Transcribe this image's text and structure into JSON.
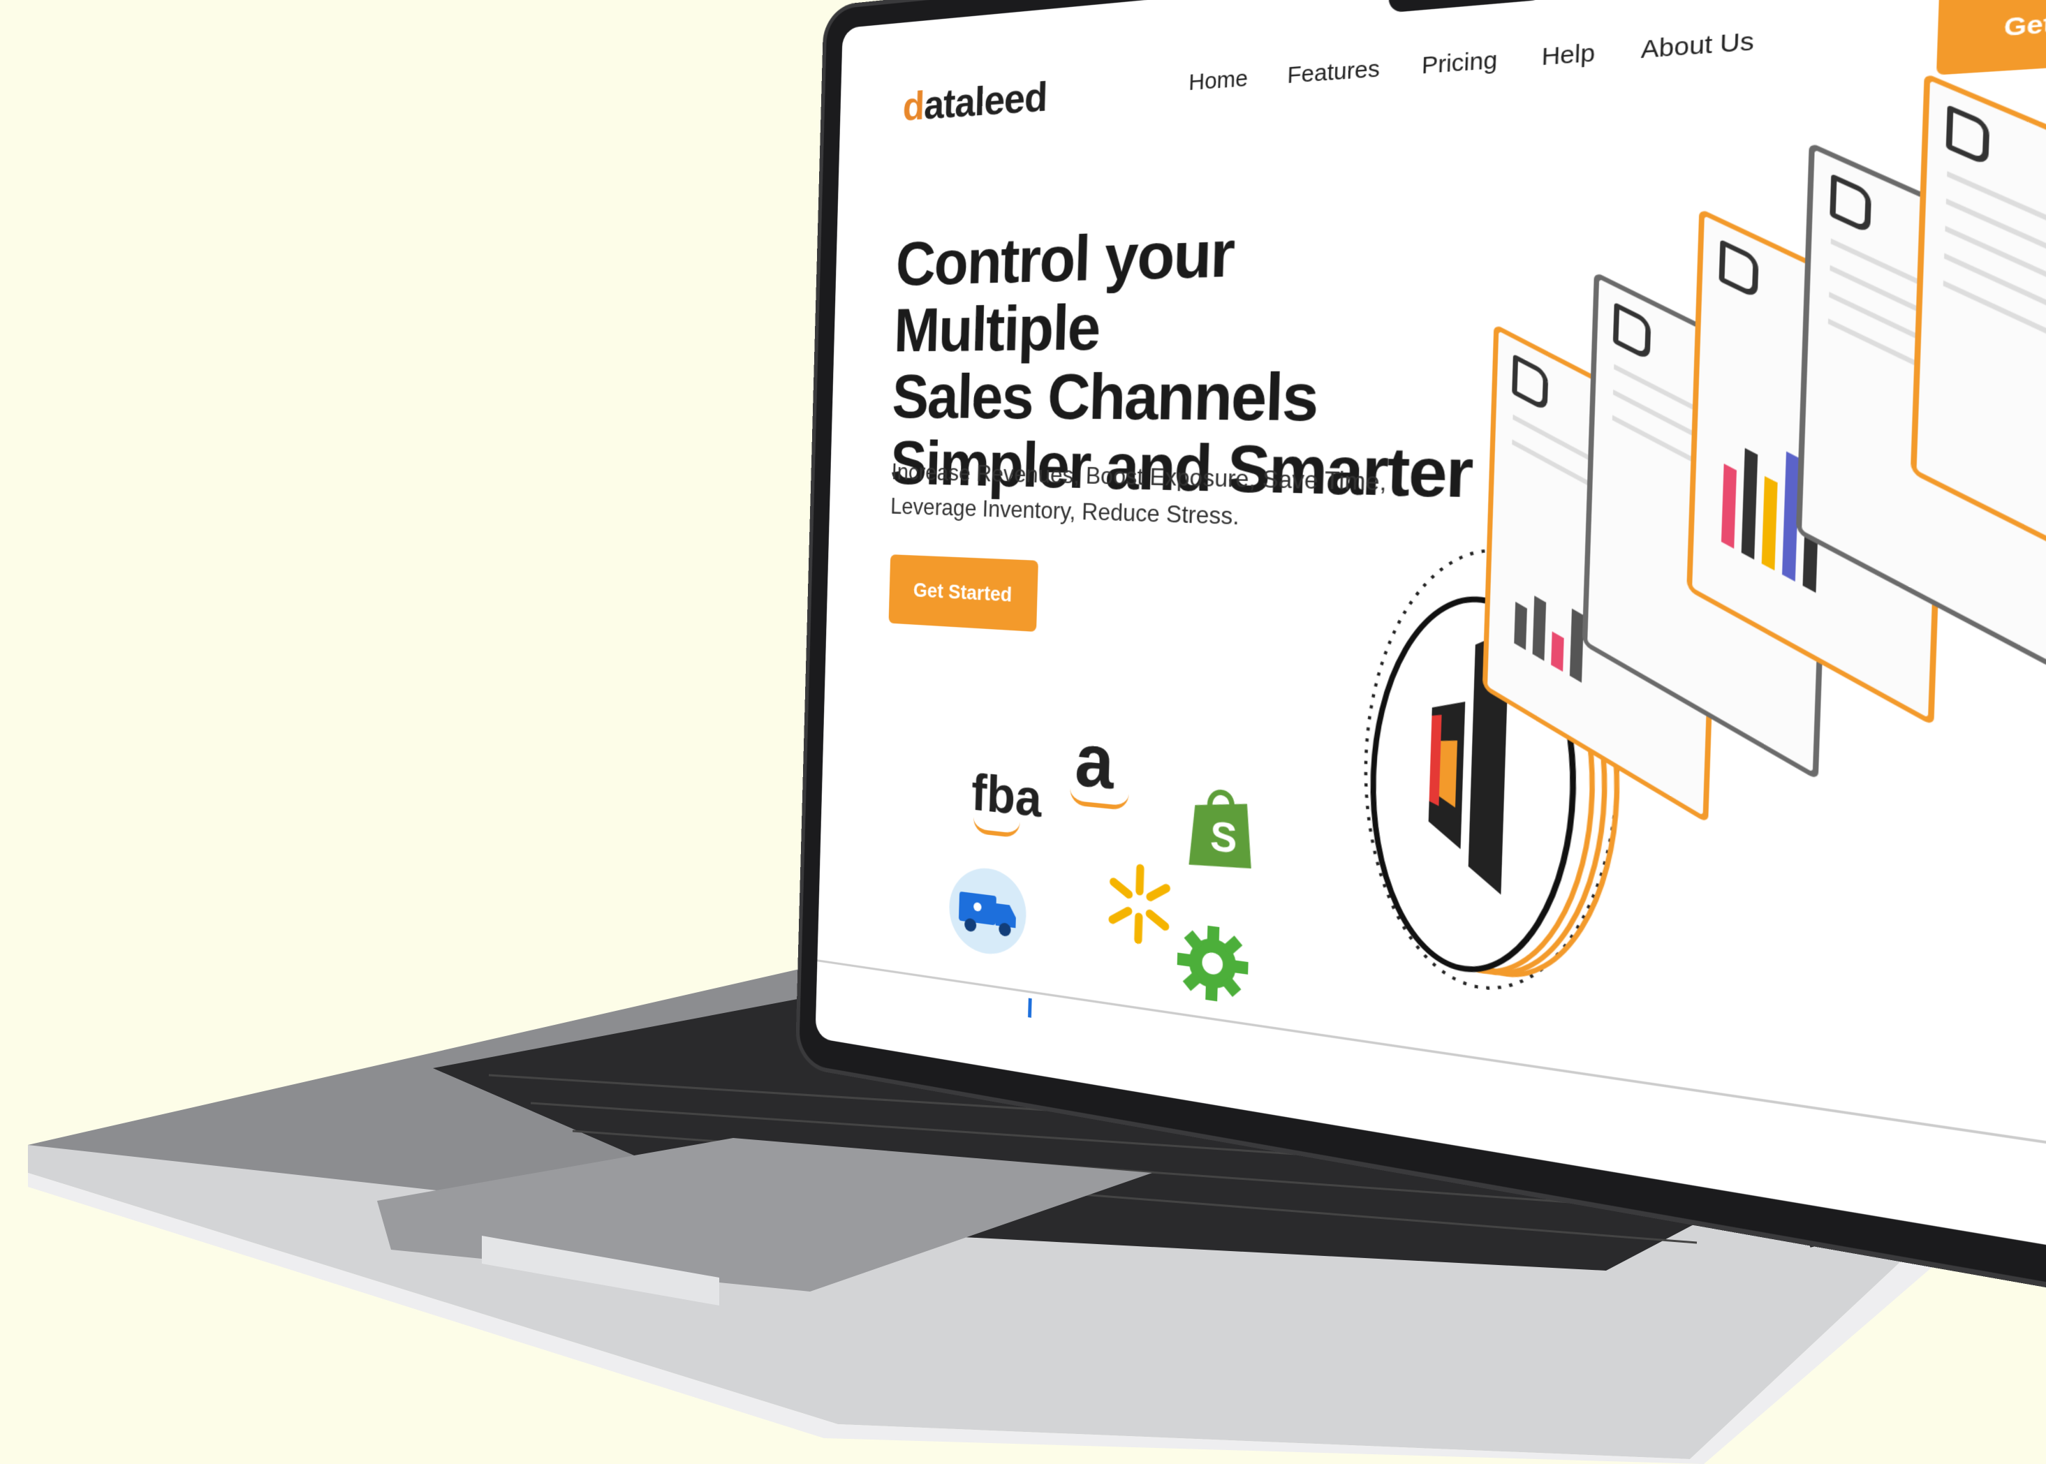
{
  "brand": {
    "logo_first": "d",
    "logo_rest": "ataleed"
  },
  "nav": {
    "links": [
      "Home",
      "Features",
      "Pricing",
      "Help",
      "About Us"
    ],
    "cta_label": "Get Started"
  },
  "hero": {
    "title_line1": "Control your Multiple",
    "title_line2": "Sales Channels",
    "title_line3": "Simpler and Smarter",
    "subtitle_line1": "Increase Revenues, Boost Exposure, Save Time,",
    "subtitle_line2": "Leverage Inventory, Reduce Stress.",
    "cta_label": "Get Started"
  },
  "integrations": {
    "fba_label": "fba",
    "amazon_label": "a",
    "shopify_label": "S",
    "icons": [
      "fba-logo-icon",
      "amazon-logo-icon",
      "shopify-bag-icon",
      "walmart-spark-icon",
      "delivery-truck-icon",
      "gear-icon"
    ]
  },
  "colors": {
    "accent": "#f39a2b",
    "background": "#fdfde8",
    "text": "#1b1b1b",
    "shopify_green": "#5e9e3a",
    "walmart_yellow": "#f5b400",
    "truck_blue": "#1d6fdc"
  }
}
